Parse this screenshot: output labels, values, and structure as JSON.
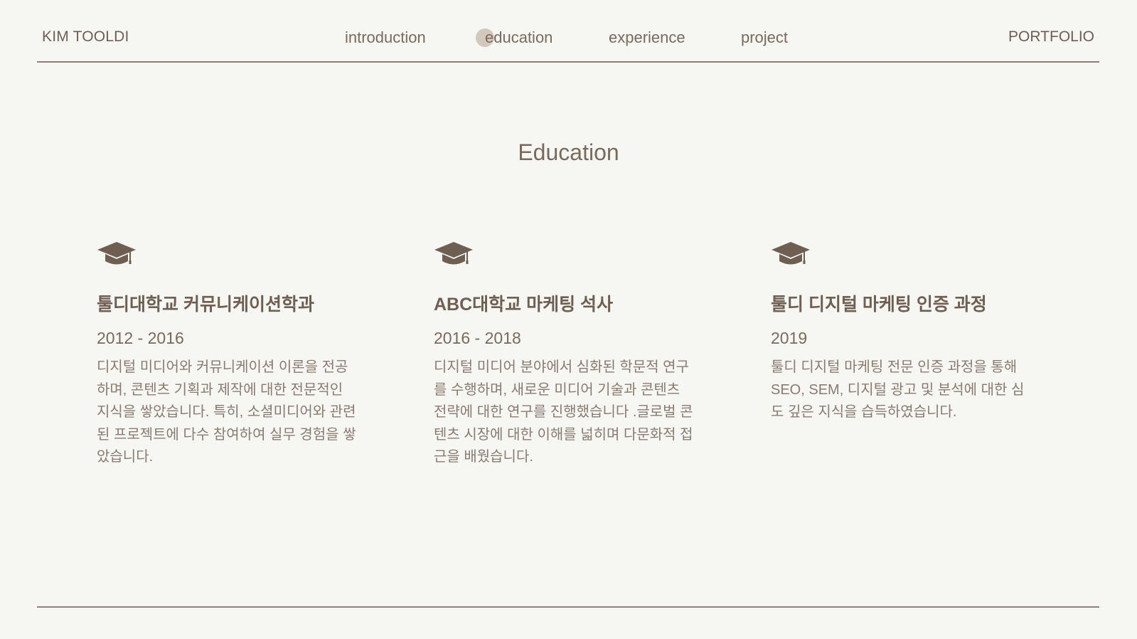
{
  "header": {
    "brand": "KIM TOOLDI",
    "right_label": "PORTFOLIO",
    "nav": [
      {
        "label": "introduction"
      },
      {
        "label": "education"
      },
      {
        "label": "experience"
      },
      {
        "label": "project"
      }
    ],
    "active_nav": "education"
  },
  "section": {
    "title": "Education"
  },
  "cards": [
    {
      "icon": "graduation-cap-icon",
      "title": "툴디대학교 커뮤니케이션학과",
      "years": "2012 - 2016",
      "description": "디지털 미디어와 커뮤니케이션 이론을 전공하며, 콘텐츠 기획과 제작에 대한 전문적인 지식을 쌓았습니다. 특히, 소셜미디어와 관련된 프로젝트에 다수 참여하여 실무 경험을 쌓았습니다."
    },
    {
      "icon": "graduation-cap-icon",
      "title": "ABC대학교 마케팅 석사",
      "years": "2016 - 2018",
      "description": "디지털 미디어 분야에서 심화된 학문적 연구를 수행하며, 새로운 미디어 기술과 콘텐츠 전략에 대한 연구를 진행했습니다 .글로벌 콘텐츠 시장에 대한 이해를 넓히며 다문화적 접근을 배웠습니다."
    },
    {
      "icon": "graduation-cap-icon",
      "title": "툴디 디지털 마케팅 인증 과정",
      "years": "2019",
      "description": "툴디 디지털 마케팅 전문 인증 과정을 통해 SEO, SEM, 디지털 광고 및 분석에 대한 심도 깊은 지식을 습득하였습니다."
    }
  ],
  "colors": {
    "background": "#f6f6f2",
    "text": "#7a6a5d",
    "accent": "#6f5f53",
    "rule": "#8f8178",
    "nav_indicator": "#cdbfb3"
  }
}
